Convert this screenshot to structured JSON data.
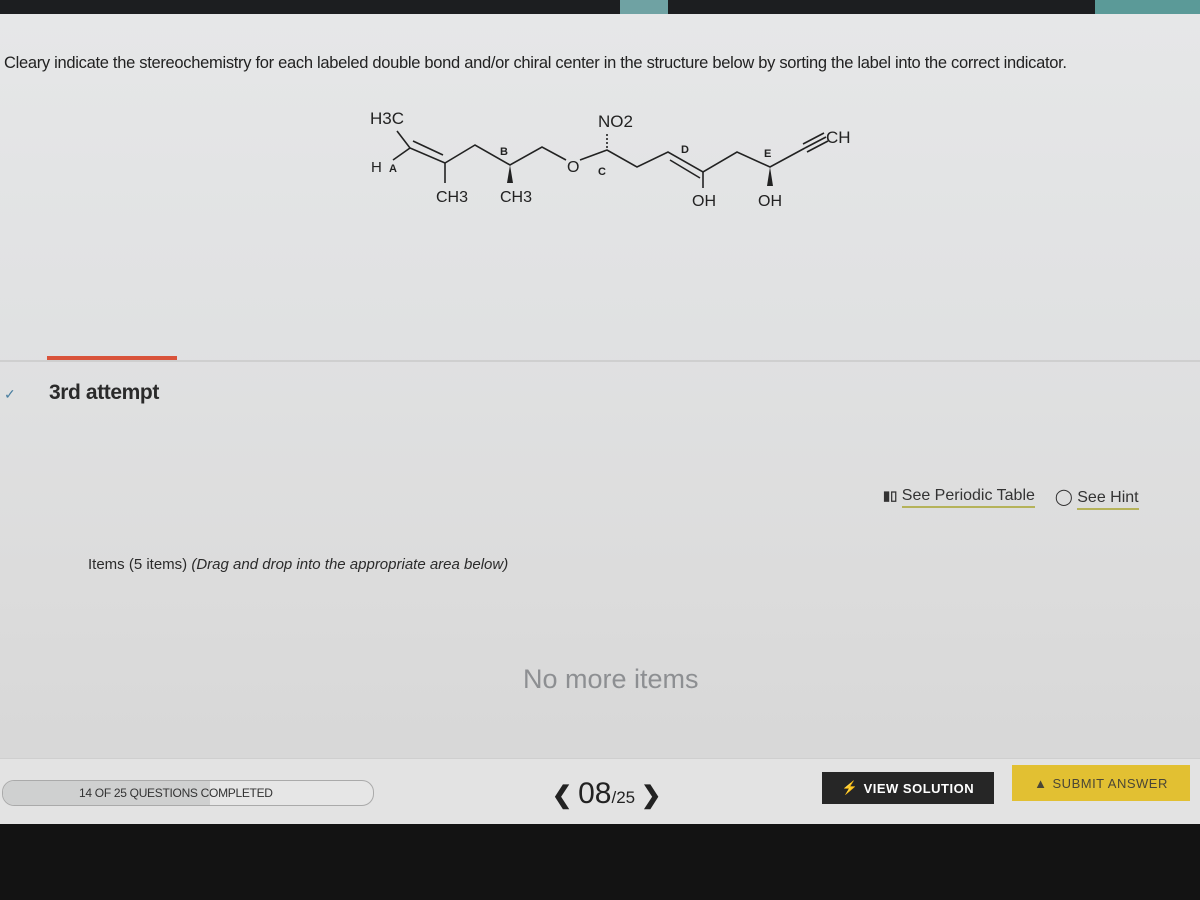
{
  "question": {
    "text": "Cleary indicate the stereochemistry for each labeled double bond and/or chiral center in the structure below by sorting the label into the correct indicator."
  },
  "molecule": {
    "h3c": "H3C",
    "h": "H",
    "labels": {
      "a": "A",
      "b": "B",
      "c": "C",
      "d": "D",
      "e": "E"
    },
    "o": "O",
    "no2": "NO2",
    "ch3_1": "CH3",
    "ch3_2": "CH3",
    "oh_1": "OH",
    "oh_2": "OH",
    "ch": "CH"
  },
  "attempt": {
    "label": "3rd attempt",
    "icon": "chevron-down-icon"
  },
  "tools": {
    "periodic_table": "See Periodic Table",
    "hint": "See Hint"
  },
  "items": {
    "title": "Items (5 items)",
    "instruction": "(Drag and drop into the appropriate area below)",
    "empty": "No more items"
  },
  "footer": {
    "progress_text": "14 OF 25 QUESTIONS COMPLETED",
    "progress_fraction": 0.56,
    "current": "08",
    "total": "/25",
    "view_solution": "VIEW SOLUTION",
    "submit_answer": "SUBMIT ANSWER"
  },
  "colors": {
    "submit": "#e2c032",
    "view": "#262626",
    "accent_bar": "#d9533b"
  }
}
